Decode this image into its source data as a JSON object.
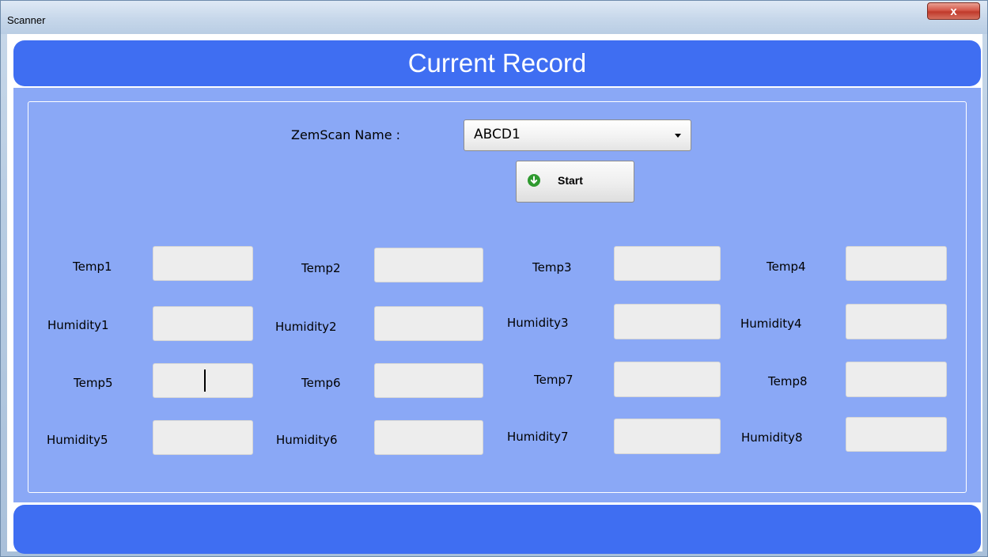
{
  "window": {
    "title": "Scanner",
    "close_label": "x"
  },
  "header": {
    "title": "Current Record"
  },
  "form": {
    "zemscan_label": "ZemScan Name :",
    "zemscan_value": "ABCD1",
    "start_label": "Start"
  },
  "fields": {
    "temp1": "Temp1",
    "temp2": "Temp2",
    "temp3": "Temp3",
    "temp4": "Temp4",
    "humidity1": "Humidity1",
    "humidity2": "Humidity2",
    "humidity3": "Humidity3",
    "humidity4": "Humidity4",
    "temp5": "Temp5",
    "temp6": "Temp6",
    "temp7": "Temp7",
    "temp8": "Temp8",
    "humidity5": "Humidity5",
    "humidity6": "Humidity6",
    "humidity7": "Humidity7",
    "humidity8": "Humidity8"
  },
  "colors": {
    "header_band": "#3f6ef2",
    "panel": "#8aa8f6",
    "field_bg": "#ededed",
    "start_icon": "#2f9a2f"
  }
}
